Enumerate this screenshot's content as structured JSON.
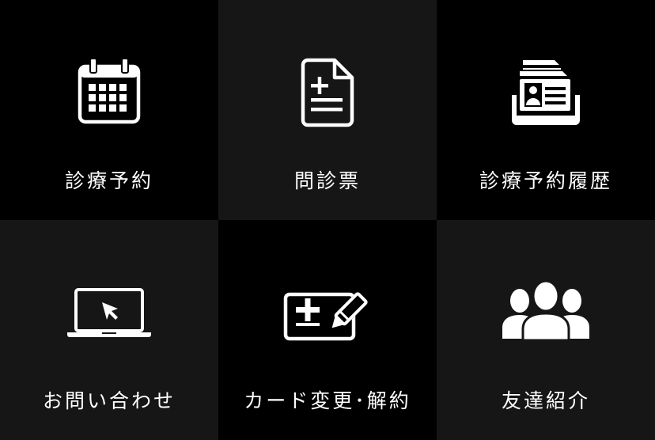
{
  "menu": {
    "items": [
      {
        "label": "診療予約",
        "icon": "calendar-icon"
      },
      {
        "label": "問診票",
        "icon": "medical-document-icon"
      },
      {
        "label": "診療予約履歴",
        "icon": "patient-records-icon"
      },
      {
        "label": "お問い合わせ",
        "icon": "laptop-cursor-icon"
      },
      {
        "label": "カード変更･解約",
        "icon": "card-edit-icon"
      },
      {
        "label": "友達紹介",
        "icon": "group-people-icon"
      }
    ]
  },
  "colors": {
    "tile_dark": "#000000",
    "tile_light": "#161616",
    "foreground": "#ffffff"
  }
}
